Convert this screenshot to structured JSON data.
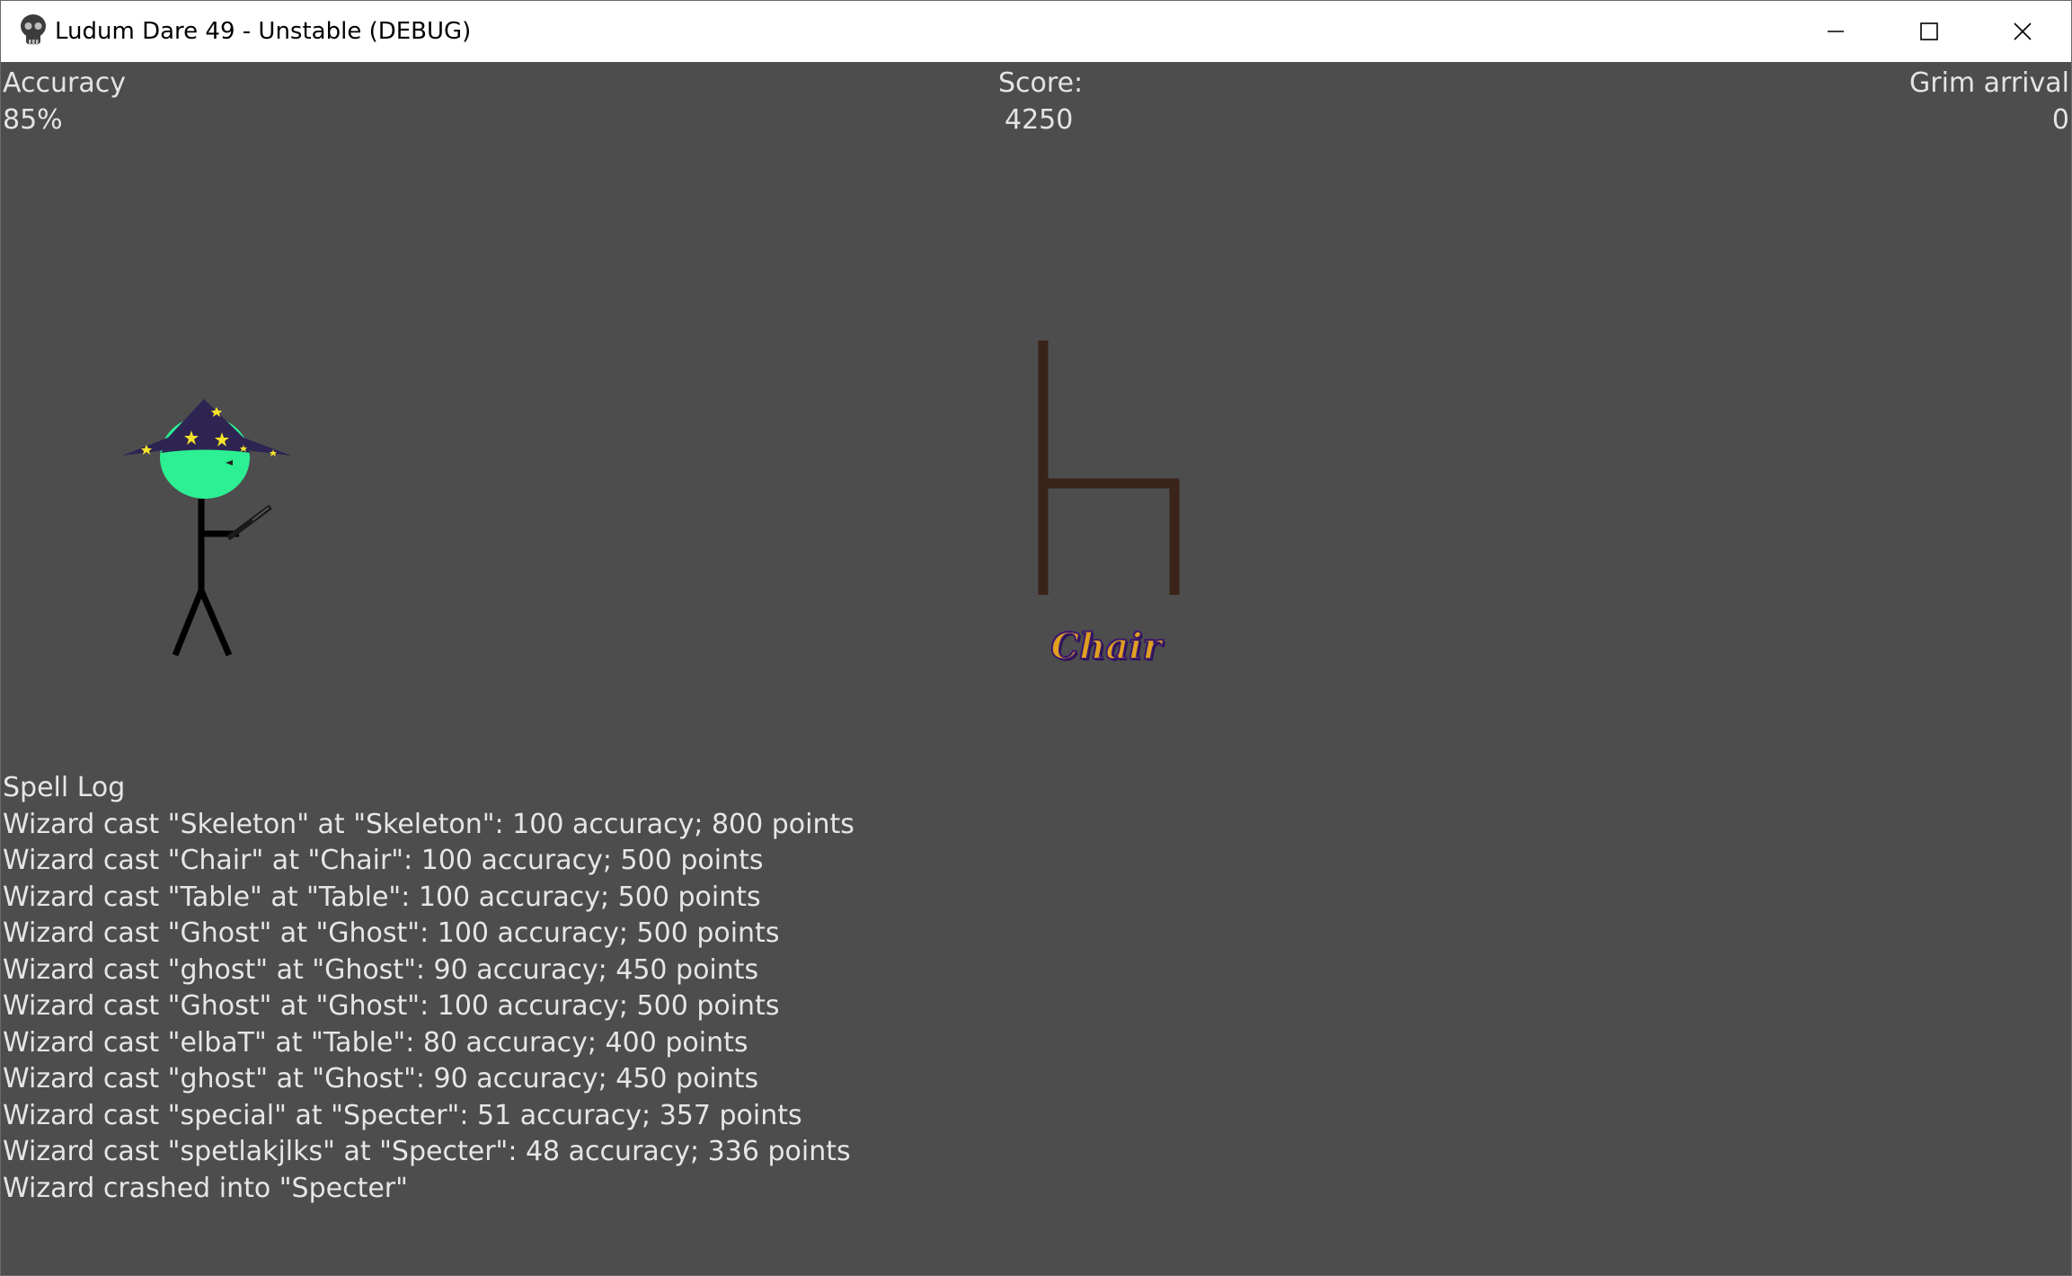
{
  "window": {
    "title": "Ludum Dare 49 - Unstable (DEBUG)",
    "app_icon": "skull-icon",
    "controls": [
      "minimize-icon",
      "maximize-icon",
      "close-icon"
    ]
  },
  "hud": {
    "accuracy_label": "Accuracy",
    "accuracy_value": "85%",
    "score_label": "Score:",
    "score_value": "4250",
    "grim_label": "Grim arrival",
    "grim_value": "0"
  },
  "scene": {
    "target_word": "Chair",
    "colors": {
      "background": "#4d4d4d",
      "hat": "#2e2452",
      "stars": "#f5e32a",
      "face": "#2cf093",
      "chair": "#3a2418",
      "label_fill": "#e0a020",
      "label_outline": "#3a1a6a"
    }
  },
  "spell_log": {
    "title": "Spell Log",
    "entries": [
      "Wizard cast \"Skeleton\" at \"Skeleton\": 100 accuracy; 800 points",
      "Wizard cast \"Chair\" at \"Chair\": 100 accuracy; 500 points",
      "Wizard cast \"Table\" at \"Table\": 100 accuracy; 500 points",
      "Wizard cast \"Ghost\" at \"Ghost\": 100 accuracy; 500 points",
      "Wizard cast \"ghost\" at \"Ghost\": 90 accuracy; 450 points",
      "Wizard cast \"Ghost\" at \"Ghost\": 100 accuracy; 500 points",
      "Wizard cast \"elbaT\" at \"Table\": 80 accuracy; 400 points",
      "Wizard cast \"ghost\" at \"Ghost\": 90 accuracy; 450 points",
      "Wizard cast \"special\" at \"Specter\": 51 accuracy; 357 points",
      "Wizard cast \"spetlakjlks\" at \"Specter\": 48 accuracy; 336 points",
      "Wizard crashed into \"Specter\""
    ]
  }
}
